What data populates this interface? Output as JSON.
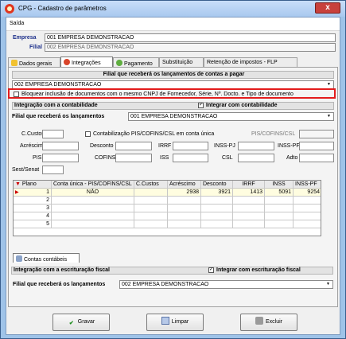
{
  "window": {
    "title": "CPG - Cadastro de parâmetros",
    "close_symbol": "x"
  },
  "menu": {
    "exit": "Saída"
  },
  "header": {
    "empresa_label": "Empresa",
    "empresa_value": "001 EMPRESA DEMONSTRACAO",
    "filial_label": "Filial",
    "filial_value": "002 EMPRESA DEMONSTRACAO"
  },
  "tabs": [
    {
      "label": "Dados gerais",
      "icon": "warning-sign-icon"
    },
    {
      "label": "Integrações",
      "icon": "swirl-icon"
    },
    {
      "label": "Pagamento",
      "icon": "leaf-icon"
    },
    {
      "label": "Substituição",
      "icon": ""
    },
    {
      "label": "Retenção de impostos - FLP",
      "icon": ""
    }
  ],
  "contas_pagar": {
    "section_title": "Filial que receberá os lançamentos de contas a pagar",
    "filial_value": "002 EMPRESA DEMONSTRACAO",
    "block_label": "Bloquear inclusão de documentos com o mesmo CNPJ de Fornecedor, Série, Nº. Docto. e Tipo de documento"
  },
  "contabilidade": {
    "section_title": "Integração com a contabilidade",
    "integrar_label": "Integrar com contabilidade",
    "integrar_checked": "✓",
    "filial_label": "Filial que receberá os lançamentos",
    "filial_value": "001 EMPRESA DEMONSTRACAO",
    "fields": {
      "c_custos": "C.Custos",
      "contabilizacao": "Contabilização PIS/COFINS/CSL em conta única",
      "pis_cofins_csl": "PIS/COFINS/CSL",
      "acrescimo": "Acréscimo",
      "desconto": "Desconto",
      "irrf": "IRRF",
      "inss_pj": "INSS-PJ",
      "inss_pf": "INSS-PF",
      "pis": "PIS",
      "cofins": "COFINS",
      "iss": "ISS",
      "csl": "CSL",
      "adto": "Adto",
      "sest_senat": "Sest/Senat"
    },
    "grid": {
      "headers": [
        "Plano",
        "Conta única - PIS/COFINS/CSL",
        "C.Custos",
        "Acréscimo",
        "Desconto",
        "IRRF",
        "INSS",
        "INSS-PF"
      ],
      "rows": [
        [
          "1",
          "NÃO",
          "",
          "2938",
          "3921",
          "1413",
          "5091",
          "9254"
        ],
        [
          "2",
          "",
          "",
          "",
          "",
          "",
          "",
          ""
        ],
        [
          "3",
          "",
          "",
          "",
          "",
          "",
          "",
          ""
        ],
        [
          "4",
          "",
          "",
          "",
          "",
          "",
          "",
          ""
        ],
        [
          "5",
          "",
          "",
          "",
          "",
          "",
          "",
          ""
        ]
      ]
    },
    "subtab": "Contas contábeis"
  },
  "fiscal": {
    "section_title": "Integração com a escrituração fiscal",
    "integrar_label": "Integrar com escrituração fiscal",
    "integrar_checked": "✓",
    "filial_label": "Filial que receberá os lançamentos",
    "filial_value": "002 EMPRESA DEMONSTRACAO"
  },
  "buttons": {
    "save": "Gravar",
    "clear": "Limpar",
    "delete": "Excluir"
  },
  "colors": {
    "highlight": "#e31c1c",
    "title_bar": "#a8c8ee"
  }
}
